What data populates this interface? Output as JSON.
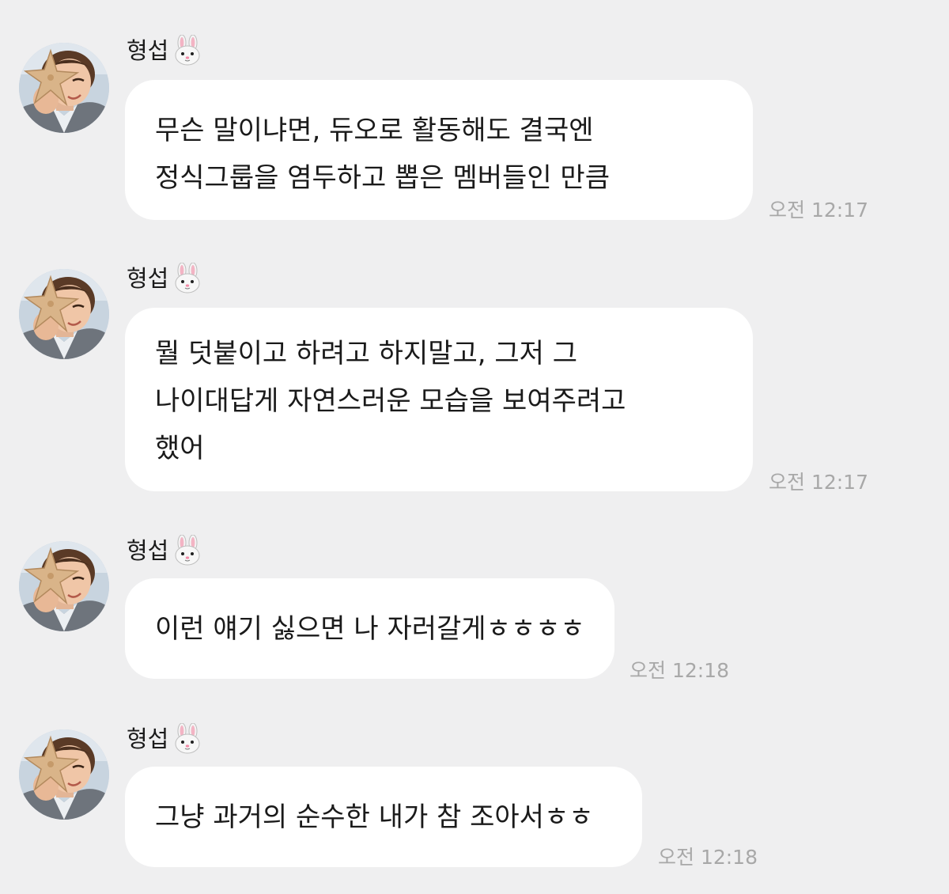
{
  "sender_name": "형섭",
  "sender_emoji_icon": "rabbit-face-icon",
  "messages": [
    {
      "lines": [
        "무슨 말이냐면, 듀오로 활동해도 결국엔",
        "정식그룹을 염두하고 뽑은 멤버들인 만큼"
      ],
      "time": "오전 12:17"
    },
    {
      "lines": [
        "뭘 덧붙이고 하려고 하지말고, 그저 그",
        "나이대답게 자연스러운 모습을 보여주려고",
        "했어"
      ],
      "time": "오전 12:17"
    },
    {
      "lines": [
        "이런 얘기 싫으면 나 자러갈게ㅎㅎㅎㅎ"
      ],
      "time": "오전 12:18"
    },
    {
      "lines": [
        "그냥 과거의 순수한 내가 참 조아서ㅎㅎ"
      ],
      "time": "오전 12:18"
    }
  ]
}
